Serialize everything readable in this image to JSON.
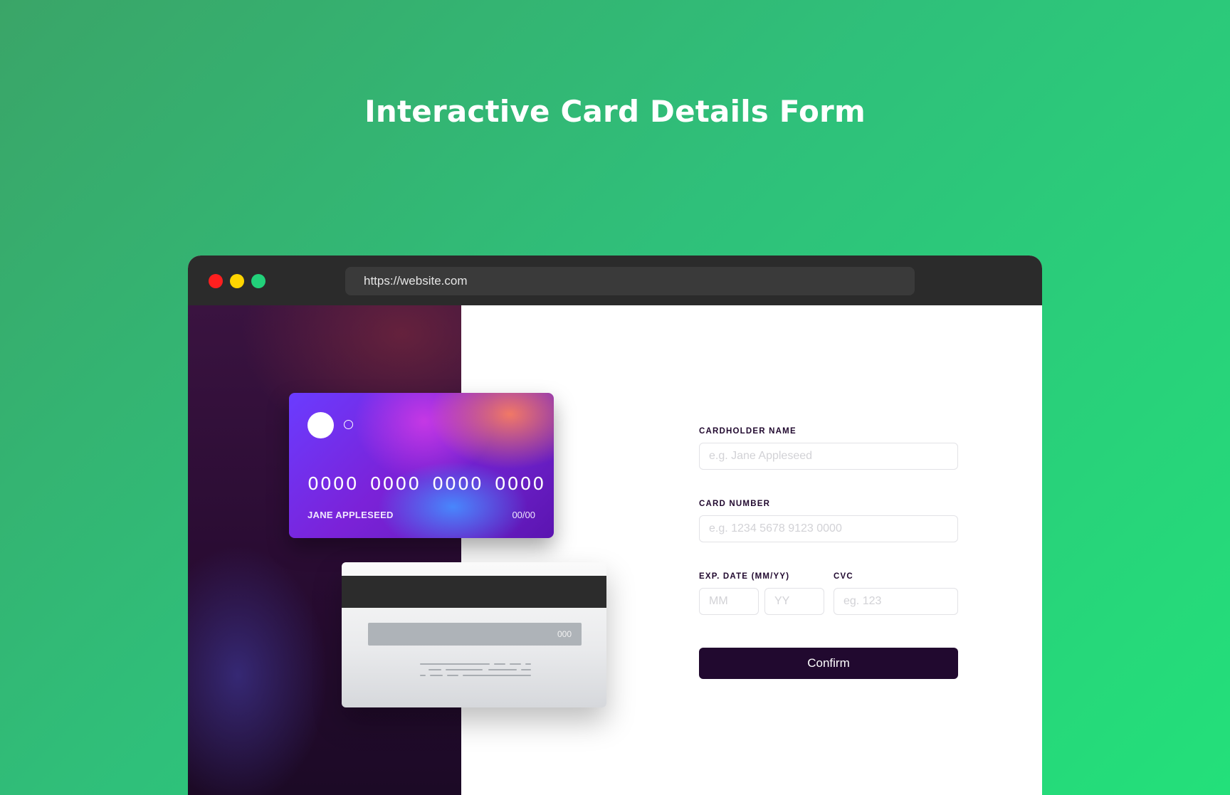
{
  "page": {
    "title": "Interactive Card Details Form"
  },
  "browser": {
    "url": "https://website.com"
  },
  "card_front": {
    "number": "0000 0000 0000 0000",
    "name": "JANE APPLESEED",
    "expiry": "00/00"
  },
  "card_back": {
    "cvc": "000"
  },
  "form": {
    "cardholder_label": "CARDHOLDER NAME",
    "cardholder_placeholder": "e.g. Jane Appleseed",
    "card_number_label": "CARD NUMBER",
    "card_number_placeholder": "e.g. 1234 5678 9123 0000",
    "exp_label": "EXP. DATE (MM/YY)",
    "mm_placeholder": "MM",
    "yy_placeholder": "YY",
    "cvc_label": "CVC",
    "cvc_placeholder": "eg. 123",
    "confirm_label": "Confirm"
  },
  "colors": {
    "background_start": "#3aa568",
    "background_end": "#23e07a",
    "button": "#21092f",
    "close_dot": "#ff1f1f",
    "minimize_dot": "#ffd500",
    "maximize_dot": "#22d17a"
  }
}
